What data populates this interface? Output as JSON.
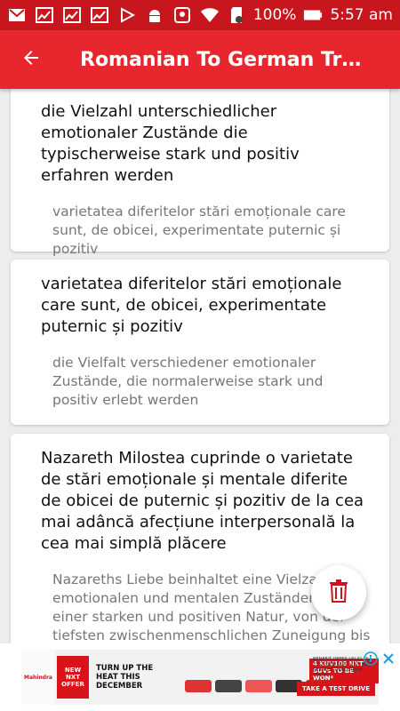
{
  "status_bar": {
    "battery": "100%",
    "time": "5:57 am",
    "icons": [
      "gmail-icon",
      "chart-icon",
      "chart-icon",
      "chart-icon",
      "play-store-icon",
      "android-icon",
      "map-icon",
      "wifi-icon",
      "sd-card-icon",
      "battery-icon"
    ]
  },
  "app_bar": {
    "title": "Romanian To German Trans...",
    "back_icon": "arrow-back-icon",
    "color": "#e8262d"
  },
  "cards": [
    {
      "source": "die Vielzahl unterschiedlicher emotionaler Zustände die typischerweise stark und positiv erfahren werden",
      "translation": "varietatea diferitelor stări emoționale care sunt, de obicei, experimentate puternic și pozitiv"
    },
    {
      "source": "varietatea diferitelor stări emoționale care sunt, de obicei, experimentate puternic și pozitiv",
      "translation": "die Vielfalt verschiedener emotionaler Zustände, die normalerweise stark und positiv erlebt werden"
    },
    {
      "source": "Nazareth Milostea cuprinde o varietate de stări emoționale și mentale diferite de obicei de puternic și pozitiv de la cea mai adâncă afecțiune interpersonală la cea mai simplă plăcere",
      "translation": "Nazareths Liebe beinhaltet eine Vielzahl emotionalen und mentalen Zuständen von einer starken und positiven Natur, von der tiefsten zwischenmenschlichen Zuneigung bis"
    }
  ],
  "fab": {
    "icon": "trash-icon"
  },
  "ad": {
    "brand": "Mahindra",
    "badge": "NEW NXT OFFER",
    "headline": "TURN UP THE HEAT THIS DECEMBER",
    "offer": "4 KUV100 NXT SUVs TO BE WON*",
    "cta": "TAKE A TEST DRIVE",
    "fine_print": "BENEFIT OFFER VALID TILL 31ST DEC 2017 VISIT YOUR NEAREST DEALERSHIP TODAY!"
  }
}
